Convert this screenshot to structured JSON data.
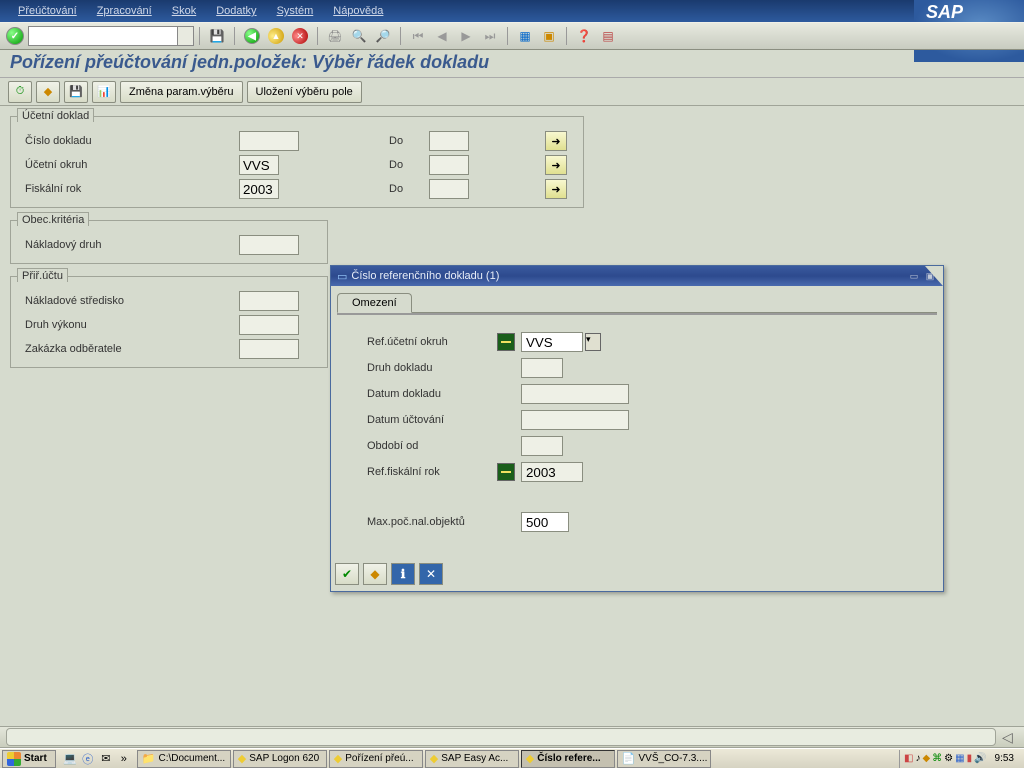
{
  "menubar": {
    "items": [
      "Přeúčtování",
      "Zpracování",
      "Skok",
      "Dodatky",
      "Systém",
      "Nápověda"
    ]
  },
  "sap_logo": "SAP",
  "page_title": "Pořízení přeúčtování jedn.položek: Výběr řádek dokladu",
  "app_toolbar": {
    "btn1": "Změna param.výběru",
    "btn2": "Uložení výběru pole"
  },
  "group1": {
    "legend": "Účetní doklad",
    "rows": [
      {
        "label": "Číslo dokladu",
        "val": "",
        "to_label": "Do",
        "to_val": ""
      },
      {
        "label": "Účetní okruh",
        "val": "VVS",
        "to_label": "Do",
        "to_val": ""
      },
      {
        "label": "Fiskální rok",
        "val": "2003",
        "to_label": "Do",
        "to_val": ""
      }
    ]
  },
  "group2": {
    "legend": "Obec.kritéria",
    "rows": [
      {
        "label": "Nákladový druh"
      }
    ]
  },
  "group3": {
    "legend": "Přiř.účtu",
    "rows": [
      {
        "label": "Nákladové středisko"
      },
      {
        "label": "Druh výkonu"
      },
      {
        "label": "Zakázka odběratele"
      }
    ]
  },
  "dialog": {
    "title": "Číslo referenčního dokladu (1)",
    "tab": "Omezení",
    "rows": {
      "r1_label": "Ref.účetní okruh",
      "r1_val": "VVS",
      "r2_label": "Druh dokladu",
      "r2_val": "",
      "r3_label": "Datum dokladu",
      "r3_val": "",
      "r4_label": "Datum účtování",
      "r4_val": "",
      "r5_label": "Období od",
      "r5_val": "",
      "r6_label": "Ref.fiskální rok",
      "r6_val": "2003",
      "r7_label": "Max.poč.nal.objektů",
      "r7_val": "500"
    }
  },
  "taskbar": {
    "start": "Start",
    "tasks": [
      {
        "label": "C:\\Document...",
        "icon": "ic-folder"
      },
      {
        "label": "SAP Logon 620",
        "icon": "ic-sap"
      },
      {
        "label": "Pořízení přeú...",
        "icon": "ic-sap"
      },
      {
        "label": "SAP Easy Ac...",
        "icon": "ic-sap"
      },
      {
        "label": "Číslo refere...",
        "icon": "ic-sap",
        "active": true
      },
      {
        "label": "VVŠ_CO-7.3....",
        "icon": "ic-doc"
      }
    ],
    "clock": "9:53"
  }
}
